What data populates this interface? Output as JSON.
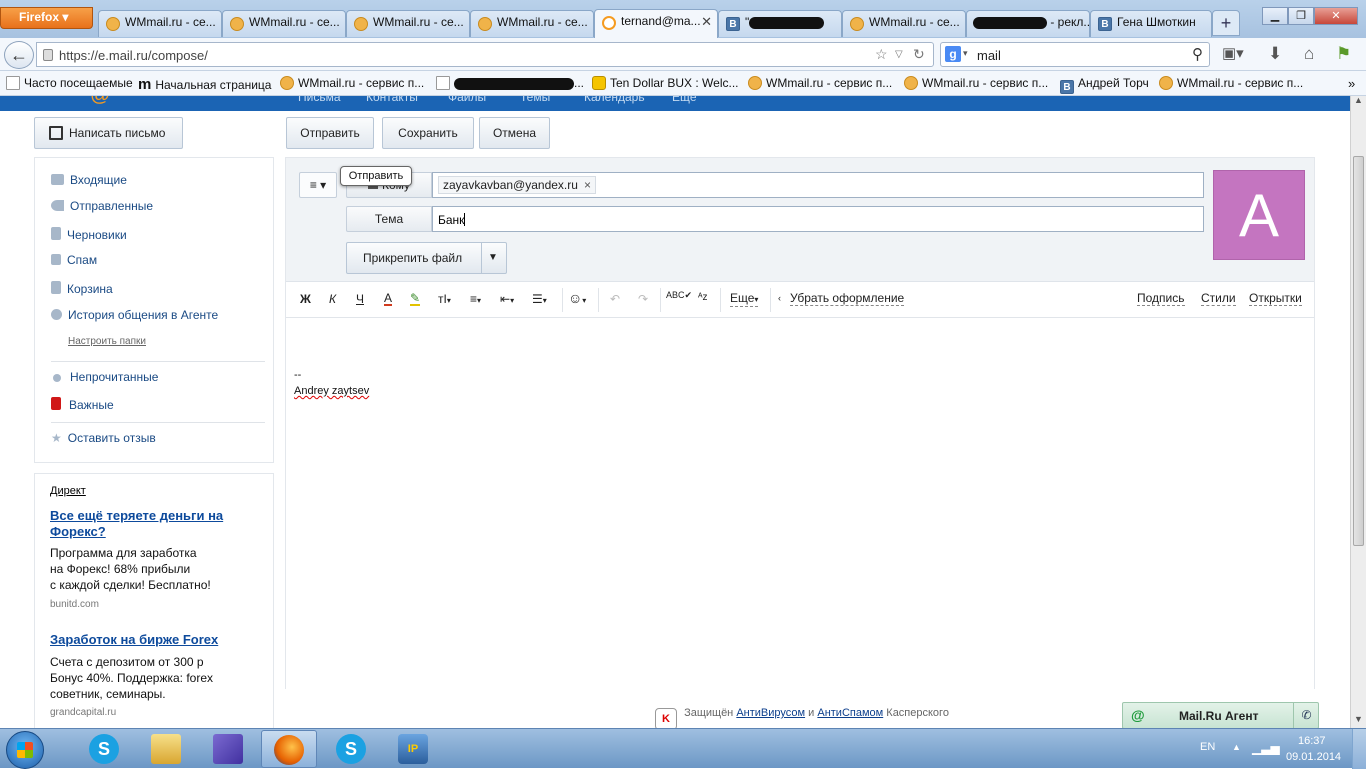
{
  "browser": {
    "menu_label": "Firefox",
    "tabs": [
      {
        "label": "WMmail.ru - се...",
        "icon": "wmmail-icon"
      },
      {
        "label": "WMmail.ru - се...",
        "icon": "wmmail-icon"
      },
      {
        "label": "WMmail.ru - се...",
        "icon": "wmmail-icon"
      },
      {
        "label": "WMmail.ru - се...",
        "icon": "wmmail-icon"
      },
      {
        "label": "ternand@ma...",
        "icon": "mailru-icon",
        "active": true
      },
      {
        "label": "\"",
        "icon": "vk-icon"
      },
      {
        "label": "WMmail.ru - се...",
        "icon": "wmmail-icon"
      },
      {
        "label": "- рекл...",
        "icon": "wmmail-icon"
      },
      {
        "label": "Гена Шмоткин",
        "icon": "vk-icon"
      }
    ],
    "url": "https://e.mail.ru/compose/",
    "search_value": "mail",
    "bookmarks": [
      "Часто посещаемые",
      "Начальная страница",
      "WMmail.ru - сервис п...",
      "...",
      "Ten Dollar BUX : Welc...",
      "WMmail.ru - сервис п...",
      "WMmail.ru - сервис п...",
      "Андрей Торч",
      "WMmail.ru - сервис п..."
    ],
    "mailnav_items": [
      "Письма",
      "Контакты",
      "Файлы",
      "Темы",
      "Календарь",
      "Ещё"
    ]
  },
  "mail": {
    "compose_button": "Написать письмо",
    "send_button": "Отправить",
    "save_button": "Сохранить",
    "cancel_button": "Отмена",
    "folders": [
      "Входящие",
      "Отправленные",
      "Черновики",
      "Спам",
      "Корзина",
      "История общения в Агенте"
    ],
    "setup_folders": "Настроить папки",
    "filters": [
      "Непрочитанные",
      "Важные"
    ],
    "feedback": "Оставить отзыв",
    "ads": {
      "label": "Директ",
      "items": [
        {
          "title": "Все ещё теряете деньги на Форекс?",
          "text": [
            "Программа для заработка",
            "на Форекс! 68% прибыли",
            "с каждой сделки! Бесплатно!"
          ],
          "domain": "bunitd.com"
        },
        {
          "title": "Заработок на бирже Forex",
          "text": [
            "Счета с депозитом от 300 р",
            "Бонус 40%. Поддержка: forex",
            "советник, семинары."
          ],
          "domain": "grandcapital.ru"
        }
      ]
    },
    "compose": {
      "to_label": "Кому",
      "to_value": "zayavkavban@yandex.ru",
      "subject_label": "Тема",
      "subject_value": "Банк",
      "tooltip": "Отправить",
      "attach_button": "Прикрепить файл",
      "avatar_letter": "A",
      "avatar_color": "#c475c0",
      "toolbar": {
        "bold": "Ж",
        "italic": "К",
        "underline": "Ч",
        "text_color": "А",
        "font_size": "тI",
        "more": "Еще",
        "clear_format": "Убрать оформление",
        "signature": "Подпись",
        "styles": "Стили",
        "cards": "Открытки"
      },
      "signature_sep": "--",
      "signature_name": "Andrey zaytsev"
    },
    "footer": {
      "prefix": "Защищён",
      "antivirus": "АнтиВирусом",
      "and": "и",
      "antispam": "АнтиСпамом",
      "suffix": "Касперского"
    },
    "agent_label": "Mail.Ru Агент"
  },
  "taskbar": {
    "lang": "EN",
    "time": "16:37",
    "date": "09.01.2014"
  }
}
